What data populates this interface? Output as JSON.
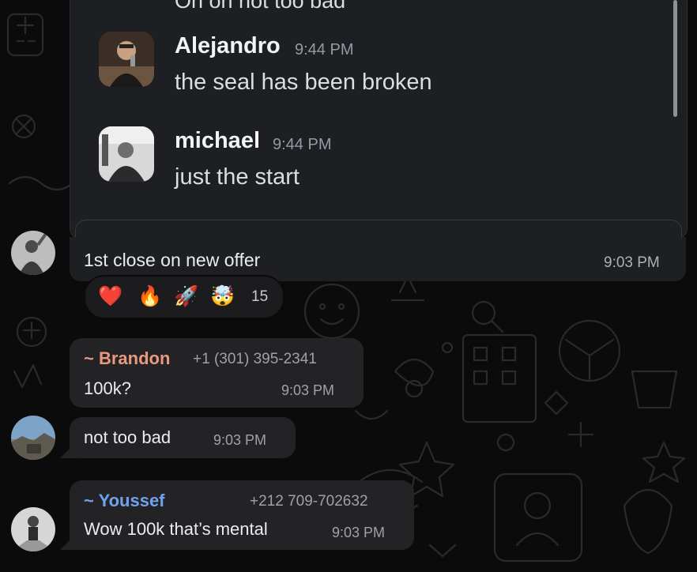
{
  "embedded": {
    "partial_top_text": "Oh oh not too bad",
    "messages": [
      {
        "name": "Alejandro",
        "time": "9:44 PM",
        "text": "the seal has been broken"
      },
      {
        "name": "michael",
        "time": "9:44 PM",
        "text": "just the start"
      }
    ]
  },
  "main_message": {
    "caption": "1st close on new offer",
    "time": "9:03 PM"
  },
  "reactions": {
    "emojis": [
      "❤️",
      "🔥",
      "🚀",
      "🤯"
    ],
    "count": "15"
  },
  "messages": [
    {
      "sender": "~ Brandon",
      "sender_color": "#e99a7e",
      "phone": "+1 (301) 395-2341",
      "text": "100k?",
      "time": "9:03 PM"
    },
    {
      "sender": "",
      "phone": "",
      "text": "not too bad",
      "time": "9:03 PM"
    },
    {
      "sender": "~ Youssef",
      "sender_color": "#6fa3f0",
      "phone": "+212 709-702632",
      "text": "Wow 100k that’s mental",
      "time": "9:03 PM"
    }
  ]
}
